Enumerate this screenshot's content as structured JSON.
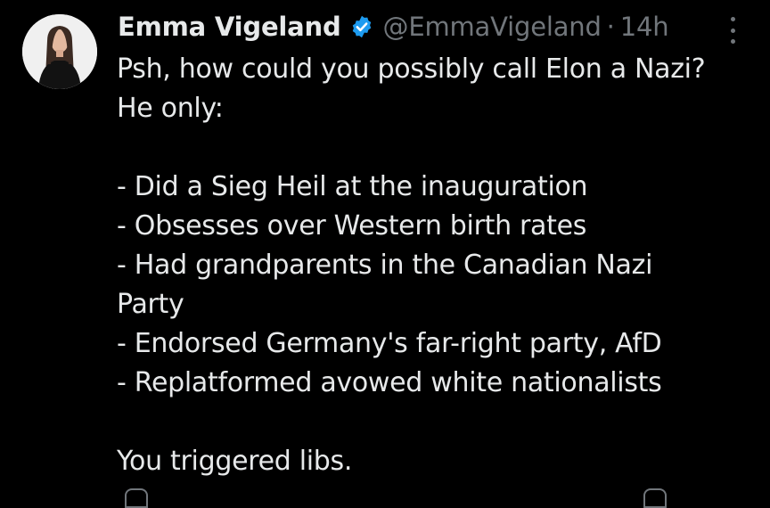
{
  "tweet": {
    "display_name": "Emma Vigeland",
    "handle": "@EmmaVigeland",
    "separator": "·",
    "time": "14h",
    "lines": [
      "Psh, how could you possibly call Elon a Nazi?",
      "He only:",
      "",
      "- Did a Sieg Heil at the inauguration",
      "- Obsesses over Western birth rates",
      "- Had grandparents in the Canadian Nazi",
      "Party",
      "- Endorsed Germany's far-right party, AfD",
      "- Replatformed avowed white nationalists",
      "",
      "You triggered libs."
    ]
  },
  "icons": {
    "verified": "verified-badge-icon",
    "more": "more-options-icon"
  },
  "colors": {
    "background": "#000000",
    "text": "#e7e9ea",
    "secondary": "#71767b",
    "verified": "#1d9bf0"
  }
}
